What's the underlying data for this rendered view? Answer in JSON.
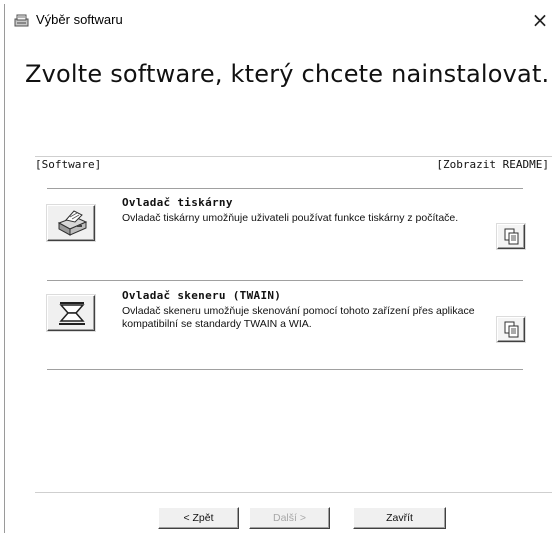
{
  "window": {
    "title": "Výběr softwaru",
    "close_glyph": "×"
  },
  "main": {
    "heading": "Zvolte software, který chcete nainstalovat.",
    "section_label": "[Software]",
    "readme_label": "[Zobrazit README]"
  },
  "software": [
    {
      "title": "Ovladač tiskárny",
      "description": "Ovladač tiskárny umožňuje uživateli používat funkce tiskárny z počítače.",
      "icon": "printer-icon"
    },
    {
      "title": "Ovladač skeneru (TWAIN)",
      "description": "Ovladač skeneru umožňuje skenování pomocí tohoto zařízení přes aplikace kompatibilní se standardy TWAIN a WIA.",
      "icon": "scanner-icon"
    }
  ],
  "footer": {
    "back_label": "< Zpět",
    "next_label": "Další >",
    "close_label": "Zavřít"
  },
  "icons": {
    "app": "software-setup-icon",
    "readme": "document-copy-icon"
  },
  "colors": {
    "disabled_text": "#a8a8a8",
    "separator": "#a0a0a0"
  }
}
